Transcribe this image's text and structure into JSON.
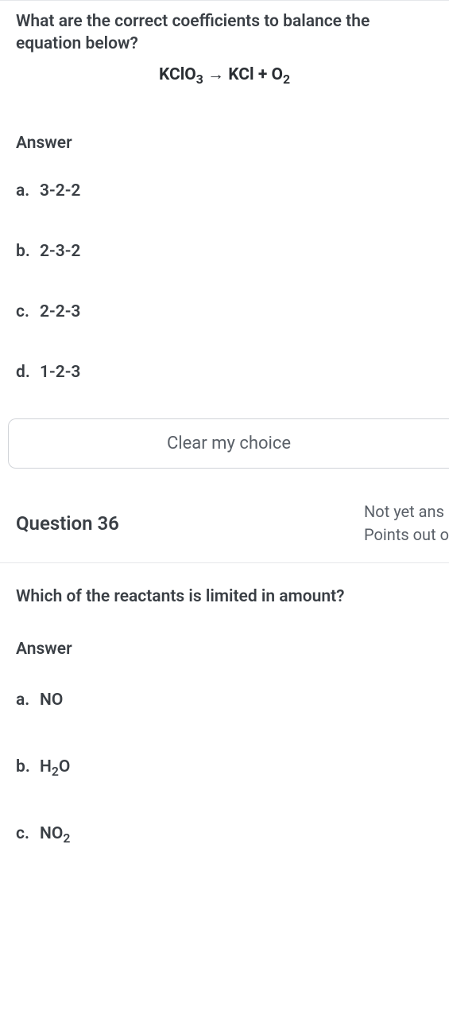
{
  "q35": {
    "prompt": "What are the correct coefficients to balance the equation below?",
    "equation_html": "KClO<sub>3</sub> → KCl + O<sub>2</sub>",
    "answer_label": "Answer",
    "options": [
      {
        "letter": "a.",
        "text": "3-2-2"
      },
      {
        "letter": "b.",
        "text": "2-3-2"
      },
      {
        "letter": "c.",
        "text": "2-2-3"
      },
      {
        "letter": "d.",
        "text": "1-2-3"
      }
    ],
    "clear_choice": "Clear my choice"
  },
  "q36": {
    "header": "Question 36",
    "status_line1": "Not yet ans",
    "status_line2": "Points out o",
    "prompt": "Which of the reactants is limited in amount?",
    "answer_label": "Answer",
    "options": [
      {
        "letter": "a.",
        "text_html": "NO"
      },
      {
        "letter": "b.",
        "text_html": "H<sub>2</sub>O"
      },
      {
        "letter": "c.",
        "text_html": "NO<sub>2</sub>"
      }
    ]
  }
}
